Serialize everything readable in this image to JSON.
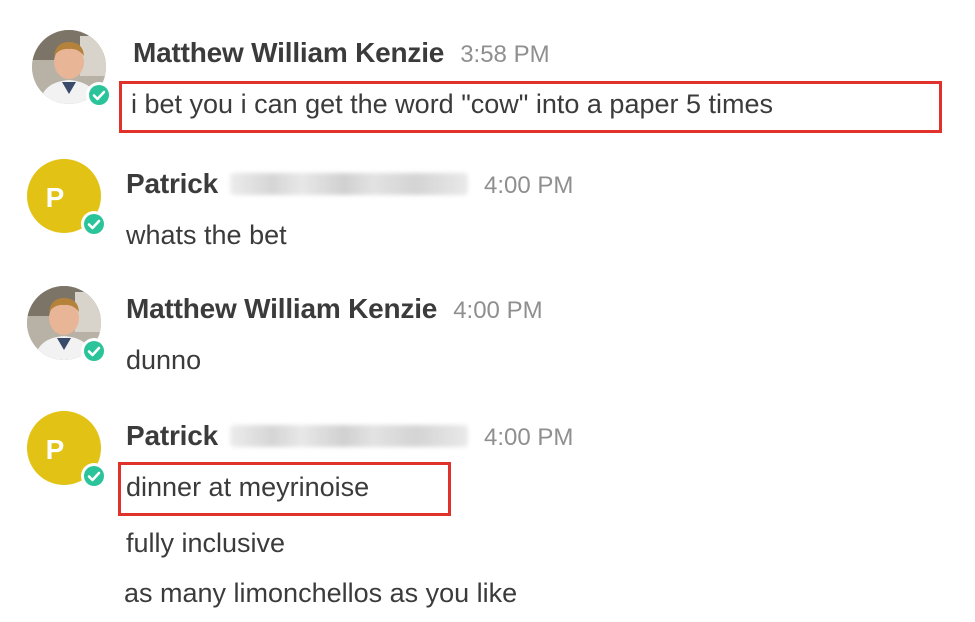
{
  "messages": [
    {
      "sender": "Matthew William Kenzie",
      "time": "3:58 PM",
      "lines": [
        "i bet you i can get the word \"cow\" into a paper 5 times"
      ]
    },
    {
      "sender": "Patrick",
      "avatar_letter": "P",
      "time": "4:00 PM",
      "lines": [
        "whats the bet"
      ]
    },
    {
      "sender": "Matthew William Kenzie",
      "time": "4:00 PM",
      "lines": [
        "dunno"
      ]
    },
    {
      "sender": "Patrick",
      "avatar_letter": "P",
      "time": "4:00 PM",
      "lines": [
        "dinner at meyrinoise",
        "fully inclusive",
        "as many limonchellos as you like"
      ]
    }
  ],
  "colors": {
    "online_status": "#2bc49a",
    "patrick_avatar_bg": "#e2c214",
    "highlight_border": "#e0322a",
    "timestamp": "#8f8f8f"
  },
  "icons": {
    "status": "online-check-icon"
  }
}
